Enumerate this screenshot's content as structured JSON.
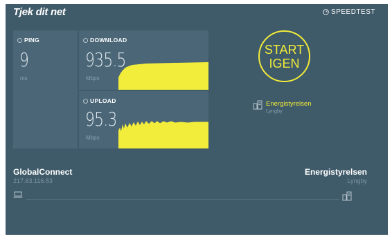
{
  "header": {
    "brand": "Tjek dit net",
    "speedtest_label": "SPEEDTEST"
  },
  "ping": {
    "label": "PING",
    "value": "9",
    "unit": "ms"
  },
  "download": {
    "label": "DOWNLOAD",
    "value": "935.5",
    "unit": "Mbps"
  },
  "upload": {
    "label": "UPLOAD",
    "value": "95.3",
    "unit": "Mbps"
  },
  "start_button": {
    "line1": "START",
    "line2": "IGEN"
  },
  "selected_server": {
    "name": "Energistyrelsen",
    "location": "Lyngby"
  },
  "isp": {
    "name": "GlobalConnect",
    "ip": "217.63.116.53"
  },
  "host": {
    "name": "Energistyrelsen",
    "location": "Lyngby"
  },
  "colors": {
    "background": "#3f5a69",
    "panel": "#4a6677",
    "accent": "#f2ec3a"
  },
  "icons": [
    "speedometer-icon",
    "ping-icon",
    "download-icon",
    "upload-icon",
    "server-icon",
    "laptop-icon"
  ]
}
